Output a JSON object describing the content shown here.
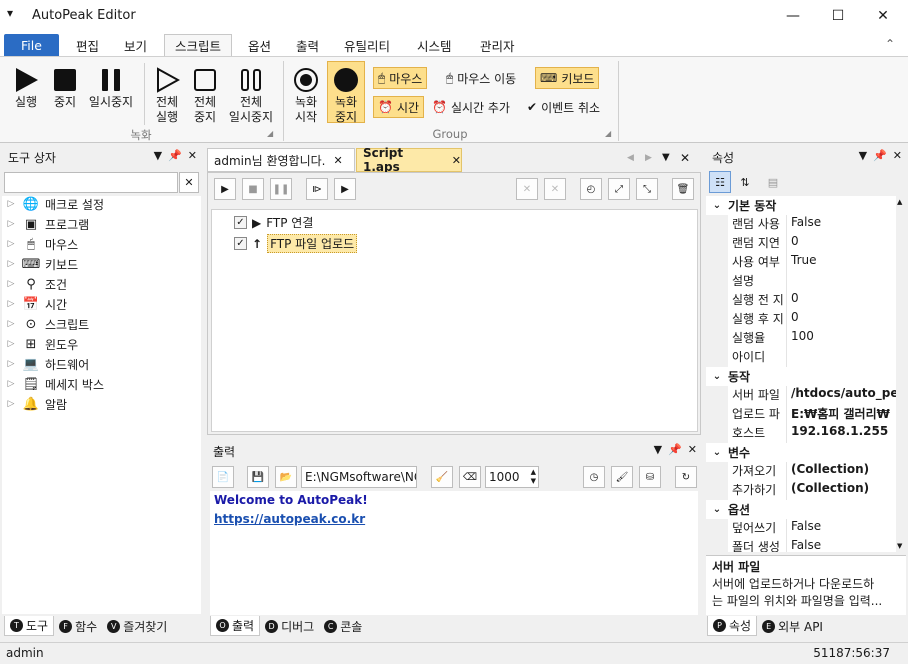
{
  "window": {
    "title": "AutoPeak Editor",
    "sysmenu_icon": "menu-chevron-icon",
    "minimize": "—",
    "maximize": "☐",
    "close": "✕"
  },
  "ribbon_tabs": [
    "File",
    "편집",
    "보기",
    "스크립트",
    "옵션",
    "출력",
    "유틸리티",
    "시스템",
    "관리자"
  ],
  "ribbon_collapse_icon": "⌃",
  "ribbon": {
    "record_group": {
      "label": "녹화",
      "buttons": [
        {
          "label1": "실행",
          "label2": ""
        },
        {
          "label1": "중지",
          "label2": ""
        },
        {
          "label1": "일시중지",
          "label2": ""
        },
        {
          "label1": "전체",
          "label2": "실행"
        },
        {
          "label1": "전체",
          "label2": "중지"
        },
        {
          "label1": "전체",
          "label2": "일시중지"
        }
      ]
    },
    "group2": {
      "label": "Group",
      "rec_start": {
        "label1": "녹화",
        "label2": "시작"
      },
      "rec_stop": {
        "label1": "녹화",
        "label2": "중지"
      },
      "mouse": "마우스",
      "mouse_move": "마우스 이동",
      "keyboard": "키보드",
      "time": "시간",
      "realtime_add": "실시간 추가",
      "event_cancel": "이벤트 취소"
    }
  },
  "toolbox": {
    "title": "도구 상자",
    "clear_btn": "✕",
    "items": [
      {
        "label": "매크로 설정",
        "icon": "globe-icon"
      },
      {
        "label": "프로그램",
        "icon": "program-window-icon"
      },
      {
        "label": "마우스",
        "icon": "mouse-icon"
      },
      {
        "label": "키보드",
        "icon": "keyboard-icon"
      },
      {
        "label": "조건",
        "icon": "condition-icon"
      },
      {
        "label": "시간",
        "icon": "calendar-icon"
      },
      {
        "label": "스크립트",
        "icon": "script-icon"
      },
      {
        "label": "윈도우",
        "icon": "windows-icon"
      },
      {
        "label": "하드웨어",
        "icon": "laptop-icon"
      },
      {
        "label": "메세지 박스",
        "icon": "message-icon"
      },
      {
        "label": "알람",
        "icon": "bell-icon"
      }
    ],
    "bottom_tabs": [
      {
        "letter": "T",
        "label": "도구"
      },
      {
        "letter": "F",
        "label": "함수"
      },
      {
        "letter": "V",
        "label": "즐겨찾기"
      }
    ]
  },
  "doc_tabs": [
    {
      "label": "admin님 환영합니다."
    },
    {
      "label": "Script 1.aps"
    }
  ],
  "script": {
    "nodes": [
      {
        "label": "FTP 연결",
        "checked": true
      },
      {
        "label": "FTP 파일 업로드",
        "checked": true
      }
    ]
  },
  "output": {
    "title": "출력",
    "path": "E:\\NGMsoftware\\NG",
    "count": "1000",
    "line1": "Welcome to AutoPeak!",
    "line2": "https://autopeak.co.kr",
    "bottom_tabs": [
      {
        "letter": "O",
        "label": "출력"
      },
      {
        "letter": "D",
        "label": "디버그"
      },
      {
        "letter": "C",
        "label": "콘솔"
      }
    ]
  },
  "properties": {
    "title": "속성",
    "categories": [
      {
        "name": "기본 동작",
        "rows": [
          {
            "k": "랜덤 사용",
            "v": "False"
          },
          {
            "k": "랜덤 지연",
            "v": "0"
          },
          {
            "k": "사용 여부",
            "v": "True"
          },
          {
            "k": "설명",
            "v": ""
          },
          {
            "k": "실행 전 지",
            "v": "0"
          },
          {
            "k": "실행 후 지",
            "v": "0"
          },
          {
            "k": "실행율",
            "v": "100"
          },
          {
            "k": "아이디",
            "v": ""
          }
        ]
      },
      {
        "name": "동작",
        "rows": [
          {
            "k": "서버 파일",
            "v": "/htdocs/auto_pe",
            "bold": true
          },
          {
            "k": "업로드 파",
            "v": "E:₩홈피 갤러리₩",
            "bold": true
          },
          {
            "k": "호스트",
            "v": "192.168.1.255",
            "bold": true
          }
        ]
      },
      {
        "name": "변수",
        "rows": [
          {
            "k": "가져오기",
            "v": "(Collection)",
            "bold": true
          },
          {
            "k": "추가하기",
            "v": "(Collection)",
            "bold": true
          }
        ]
      },
      {
        "name": "옵션",
        "rows": [
          {
            "k": "덮어쓰기",
            "v": "False"
          },
          {
            "k": "폴더 생성",
            "v": "False"
          }
        ]
      }
    ],
    "desc_title": "서버 파일",
    "desc_text1": "서버에 업로드하거나 다운로드하",
    "desc_text2": "는 파일의 위치와 파일명을 입력...",
    "bottom_tabs": [
      {
        "letter": "P",
        "label": "속성"
      },
      {
        "letter": "E",
        "label": "외부 API"
      }
    ]
  },
  "status": {
    "user": "admin",
    "time": "51187:56:37"
  }
}
